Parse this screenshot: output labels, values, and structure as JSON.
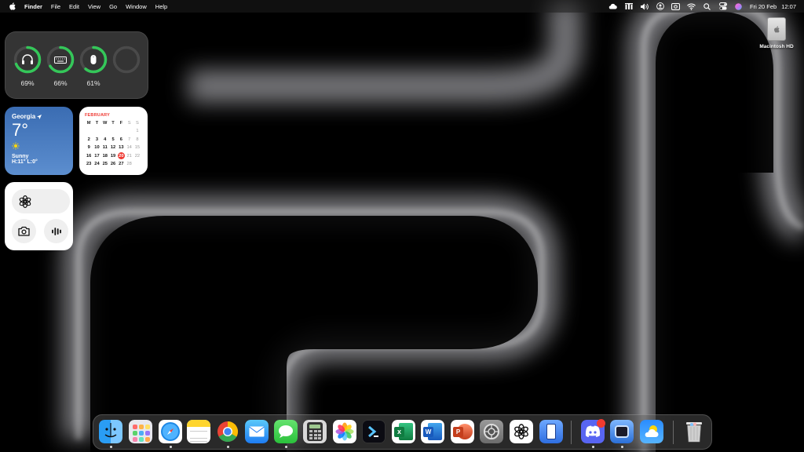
{
  "menubar": {
    "app_name": "Finder",
    "menus": [
      "File",
      "Edit",
      "View",
      "Go",
      "Window",
      "Help"
    ],
    "date": "Fri 20 Feb",
    "time": "12:07",
    "status_icons": [
      "creative-cloud-icon",
      "battery-menu-icon",
      "volume-icon",
      "user-icon",
      "screen-mirror-icon",
      "wifi-icon",
      "search-icon",
      "control-center-icon",
      "siri-icon"
    ]
  },
  "widgets": {
    "batteries": [
      {
        "device": "headphones-icon",
        "percent": "69%",
        "level": 0.69
      },
      {
        "device": "keyboard-icon",
        "percent": "66%",
        "level": 0.66
      },
      {
        "device": "mouse-icon",
        "percent": "61%",
        "level": 0.61
      },
      {
        "device": "empty",
        "percent": "",
        "level": 0
      }
    ],
    "weather": {
      "location": "Georgia",
      "temperature": "7°",
      "condition": "Sunny",
      "high_low": "H:11° L:0°"
    },
    "calendar": {
      "month": "FEBRUARY",
      "weekdays": [
        "M",
        "T",
        "W",
        "T",
        "F",
        "S",
        "S"
      ],
      "weeks": [
        [
          "",
          "",
          "",
          "",
          "",
          "",
          "1"
        ],
        [
          "2",
          "3",
          "4",
          "5",
          "6",
          "7",
          "8"
        ],
        [
          "9",
          "10",
          "11",
          "12",
          "13",
          "14",
          "15"
        ],
        [
          "16",
          "17",
          "18",
          "19",
          "20",
          "21",
          "22"
        ],
        [
          "23",
          "24",
          "25",
          "26",
          "27",
          "28",
          ""
        ]
      ],
      "today": "20"
    },
    "chatgpt": {
      "icons": [
        "chatgpt-icon",
        "camera-icon",
        "voice-icon"
      ]
    }
  },
  "desktop": {
    "items": [
      {
        "label": "Macintosh HD",
        "icon": "hard-drive-icon"
      }
    ]
  },
  "dock": {
    "apps": [
      {
        "name": "finder",
        "running": true
      },
      {
        "name": "launchpad",
        "running": false
      },
      {
        "name": "safari",
        "running": true
      },
      {
        "name": "notes",
        "running": false
      },
      {
        "name": "chrome",
        "running": true
      },
      {
        "name": "mail",
        "running": false
      },
      {
        "name": "messages",
        "running": true
      },
      {
        "name": "calculator",
        "running": false
      },
      {
        "name": "photos",
        "running": false
      },
      {
        "name": "terminal-app",
        "running": false
      },
      {
        "name": "excel",
        "running": false
      },
      {
        "name": "word",
        "running": false
      },
      {
        "name": "powerpoint",
        "running": false
      },
      {
        "name": "system-settings",
        "running": false
      },
      {
        "name": "chatgpt",
        "running": false
      },
      {
        "name": "simulator",
        "running": false
      },
      {
        "name": "discord",
        "running": true,
        "badge": true
      },
      {
        "name": "finder-window",
        "running": true
      },
      {
        "name": "weather",
        "running": false
      },
      {
        "name": "trash",
        "running": false
      }
    ]
  },
  "colors": {
    "accent_green": "#34c759",
    "calendar_red": "#ef3a33",
    "weather_blue": "#4a7cc0"
  }
}
